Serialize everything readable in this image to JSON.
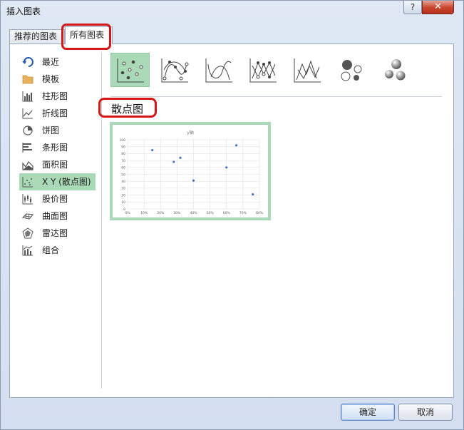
{
  "window": {
    "title": "插入图表",
    "help_label": "?",
    "close_label": "✕"
  },
  "tabs": [
    {
      "label": "推荐的图表",
      "selected": false
    },
    {
      "label": "所有图表",
      "selected": true
    }
  ],
  "sidebar": {
    "items": [
      {
        "label": "最近",
        "icon": "recent-icon",
        "selected": false
      },
      {
        "label": "模板",
        "icon": "folder-icon",
        "selected": false
      },
      {
        "label": "柱形图",
        "icon": "column-chart-icon",
        "selected": false
      },
      {
        "label": "折线图",
        "icon": "line-chart-icon",
        "selected": false
      },
      {
        "label": "饼图",
        "icon": "pie-chart-icon",
        "selected": false
      },
      {
        "label": "条形图",
        "icon": "bar-chart-icon",
        "selected": false
      },
      {
        "label": "面积图",
        "icon": "area-chart-icon",
        "selected": false
      },
      {
        "label": "X Y (散点图)",
        "icon": "scatter-chart-icon",
        "selected": true
      },
      {
        "label": "股价图",
        "icon": "stock-chart-icon",
        "selected": false
      },
      {
        "label": "曲面图",
        "icon": "surface-chart-icon",
        "selected": false
      },
      {
        "label": "雷达图",
        "icon": "radar-chart-icon",
        "selected": false
      },
      {
        "label": "组合",
        "icon": "combo-chart-icon",
        "selected": false
      }
    ]
  },
  "subtypes": [
    {
      "icon": "scatter-markers-icon",
      "selected": true
    },
    {
      "icon": "scatter-smooth-lines-markers-icon",
      "selected": false
    },
    {
      "icon": "scatter-smooth-lines-icon",
      "selected": false
    },
    {
      "icon": "scatter-straight-lines-markers-icon",
      "selected": false
    },
    {
      "icon": "scatter-straight-lines-icon",
      "selected": false
    },
    {
      "icon": "bubble-icon",
      "selected": false
    },
    {
      "icon": "bubble-3d-icon",
      "selected": false
    }
  ],
  "section": {
    "title": "散点图"
  },
  "chart_data": {
    "type": "scatter",
    "title": "y轴",
    "xlabel": "",
    "ylabel": "",
    "xlim": [
      0,
      80
    ],
    "ylim": [
      0,
      100
    ],
    "x_ticks": [
      "0%",
      "10%",
      "20%",
      "30%",
      "40%",
      "50%",
      "60%",
      "70%",
      "80%"
    ],
    "y_ticks": [
      "0",
      "10",
      "20",
      "30",
      "40",
      "50",
      "60",
      "70",
      "80",
      "90",
      "100"
    ],
    "grid": true,
    "legend": "none",
    "series": [
      {
        "x": [
          15,
          28,
          32,
          40,
          60,
          66,
          76
        ],
        "y": [
          85,
          68,
          74,
          41,
          60,
          92,
          21
        ],
        "color": "#4472c4"
      }
    ]
  },
  "buttons": {
    "ok_label": "确定",
    "cancel_label": "取消"
  },
  "colors": {
    "selected_bg": "#a9d9b7",
    "annotation_red": "#d41616",
    "marker_blue": "#4472c4"
  }
}
